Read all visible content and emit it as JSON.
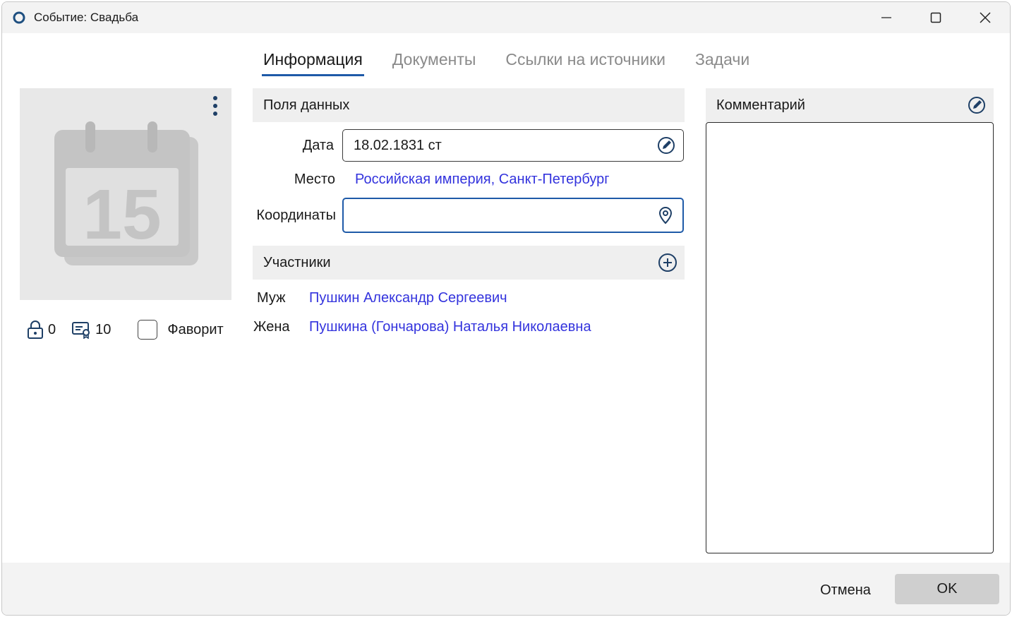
{
  "window": {
    "title": "Событие: Свадьба"
  },
  "tabs": [
    {
      "label": "Информация",
      "active": true
    },
    {
      "label": "Документы",
      "active": false
    },
    {
      "label": "Ссылки на источники",
      "active": false
    },
    {
      "label": "Задачи",
      "active": false
    }
  ],
  "image_panel": {
    "calendar_day": "15",
    "icon": "calendar-icon"
  },
  "stats": {
    "private_count": "0",
    "sources_count": "10",
    "favorite_label": "Фаворит",
    "favorite_checked": false
  },
  "data_fields": {
    "header": "Поля данных",
    "date_label": "Дата",
    "date_value": "18.02.1831 ст",
    "place_label": "Место",
    "place_value": "Российская империя, Санкт-Петербург",
    "coords_label": "Координаты",
    "coords_value": ""
  },
  "participants": {
    "header": "Участники",
    "items": [
      {
        "role": "Муж",
        "name": "Пушкин Александр Сергеевич"
      },
      {
        "role": "Жена",
        "name": "Пушкина (Гончарова) Наталья Николаевна"
      }
    ]
  },
  "comment": {
    "header": "Комментарий",
    "text": ""
  },
  "footer": {
    "cancel_label": "Отмена",
    "ok_label": "OK"
  },
  "colors": {
    "accent": "#1e5aa8",
    "link": "#3333dd",
    "panel_bg": "#efefef"
  }
}
